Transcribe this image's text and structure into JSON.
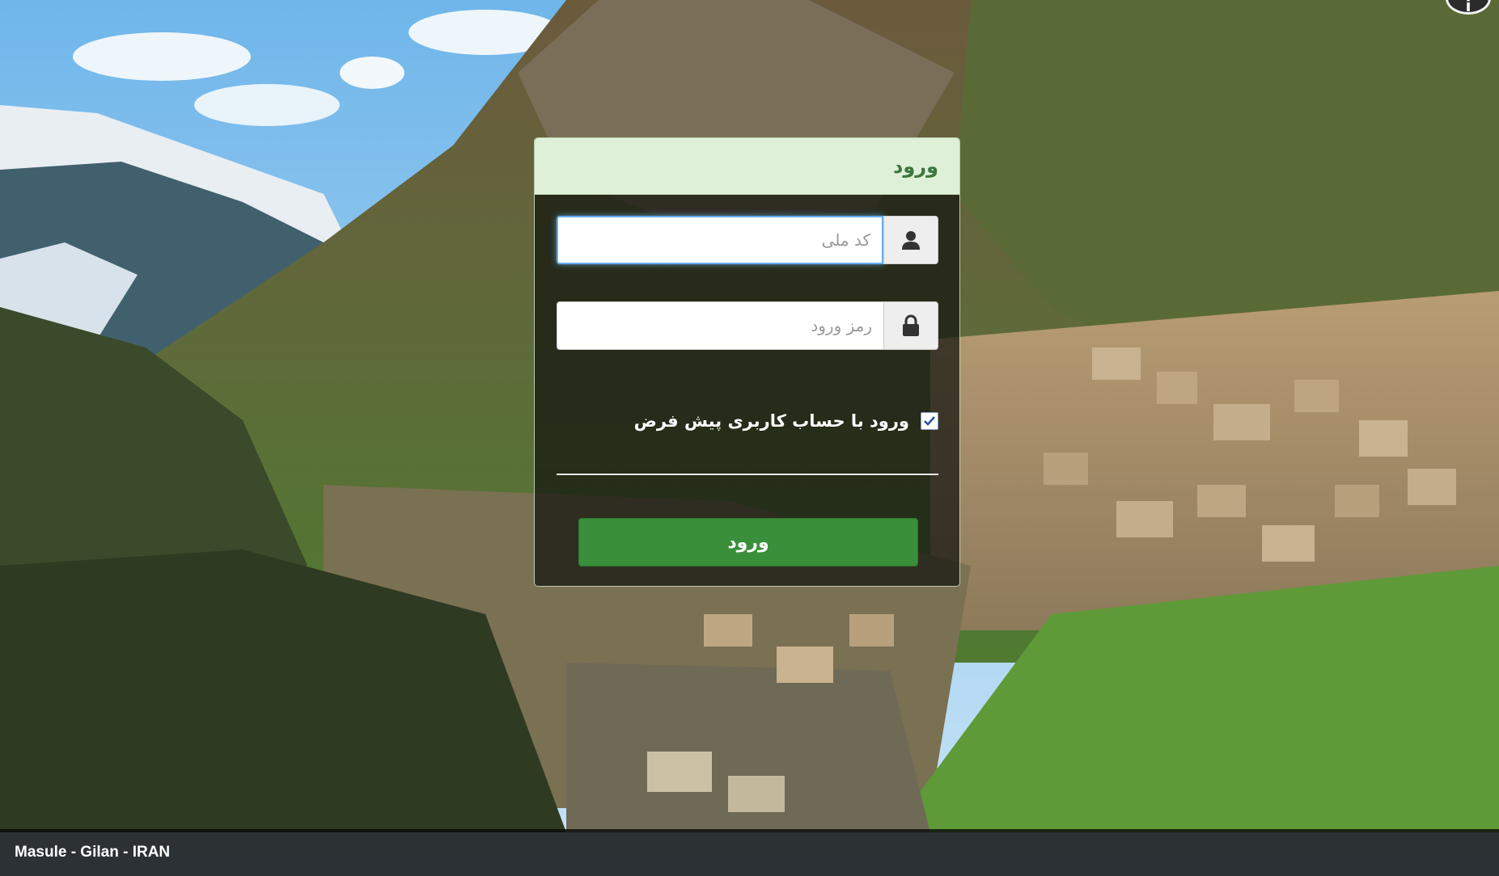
{
  "login": {
    "title": "ورود",
    "national_code_placeholder": "کد ملی",
    "national_code_value": "",
    "password_placeholder": "رمز ورود",
    "password_value": "",
    "remember_label": "ورود با حساب کاربری پیش فرض",
    "remember_checked": true,
    "submit_label": "ورود"
  },
  "background": {
    "caption": "Masule - Gilan - IRAN"
  },
  "icons": {
    "username": "user-icon",
    "password": "lock-icon",
    "corner": "help-icon"
  },
  "colors": {
    "header_bg": "#dff0d8",
    "header_text": "#3c763d",
    "submit_bg": "#3a8f3a",
    "focus_border": "#66afe9"
  }
}
